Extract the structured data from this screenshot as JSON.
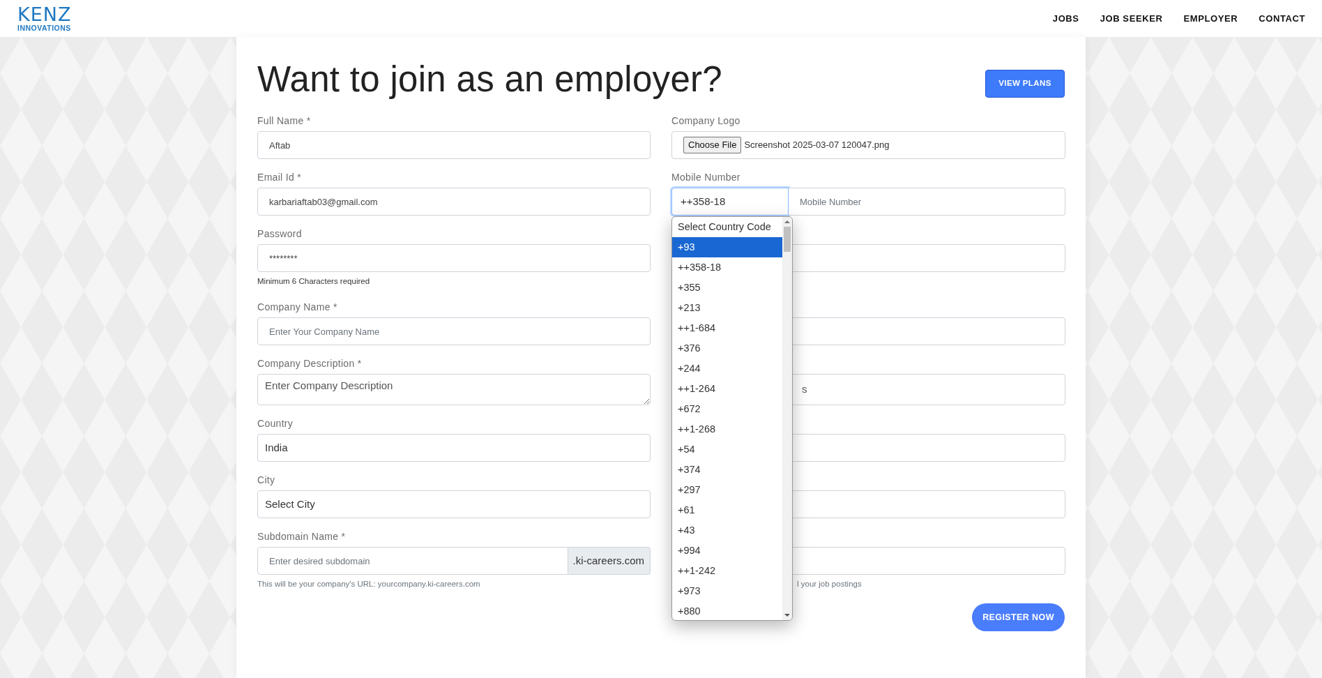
{
  "header": {
    "logo": {
      "name": "KENZ",
      "tagline": "INNOVATIONS"
    },
    "nav": [
      {
        "label": "JOBS"
      },
      {
        "label": "JOB SEEKER"
      },
      {
        "label": "EMPLOYER"
      },
      {
        "label": "CONTACT"
      }
    ]
  },
  "title": "Want to join as an employer?",
  "view_plans_button": "VIEW PLANS",
  "left_fields": [
    {
      "kind": "input",
      "label": "Full Name *",
      "value": "Aftab"
    },
    {
      "kind": "input",
      "label": "Email Id *",
      "value": "karbariaftab03@gmail.com"
    },
    {
      "kind": "input",
      "label": "Password",
      "value": "********",
      "hint": "Minimum 6 Characters required"
    },
    {
      "kind": "input",
      "label": "Company Name *",
      "placeholder": "Enter Your Company Name"
    },
    {
      "kind": "textarea",
      "label": "Company Description *",
      "placeholder": "Enter Company Description"
    },
    {
      "kind": "select",
      "label": "Country",
      "value": "India"
    },
    {
      "kind": "select",
      "label": "City",
      "value": "Select City"
    },
    {
      "kind": "addon",
      "label": "Subdomain Name *",
      "placeholder": "Enter desired subdomain",
      "suffix": ".ki-careers.com",
      "hint": "This will be your company's URL: yourcompany.ki-careers.com"
    }
  ],
  "right_fields": [
    {
      "kind": "file",
      "label": "Company Logo",
      "button": "Choose File",
      "file_name": "Screenshot 2025-03-07 120047.png"
    },
    {
      "kind": "phone",
      "label": "Mobile Number",
      "code": "++358-18",
      "placeholder": "Mobile Number"
    },
    {
      "kind": "covered_input"
    },
    {
      "kind": "covered_input"
    },
    {
      "kind": "covered_textarea",
      "text": "s"
    },
    {
      "kind": "covered_input"
    },
    {
      "kind": "covered_input"
    },
    {
      "kind": "covered_input",
      "hint": "l your job postings"
    }
  ],
  "country_code_dropdown": {
    "options": [
      {
        "label": "Select Country Code",
        "selected": false
      },
      {
        "label": "+93",
        "selected": true
      },
      {
        "label": "++358-18",
        "selected": false
      },
      {
        "label": "+355",
        "selected": false
      },
      {
        "label": "+213",
        "selected": false
      },
      {
        "label": "++1-684",
        "selected": false
      },
      {
        "label": "+376",
        "selected": false
      },
      {
        "label": "+244",
        "selected": false
      },
      {
        "label": "++1-264",
        "selected": false
      },
      {
        "label": "+672",
        "selected": false
      },
      {
        "label": "++1-268",
        "selected": false
      },
      {
        "label": "+54",
        "selected": false
      },
      {
        "label": "+374",
        "selected": false
      },
      {
        "label": "+297",
        "selected": false
      },
      {
        "label": "+61",
        "selected": false
      },
      {
        "label": "+43",
        "selected": false
      },
      {
        "label": "+994",
        "selected": false
      },
      {
        "label": "++1-242",
        "selected": false
      },
      {
        "label": "+973",
        "selected": false
      },
      {
        "label": "+880",
        "selected": false
      }
    ]
  },
  "register_button": "REGISTER NOW"
}
